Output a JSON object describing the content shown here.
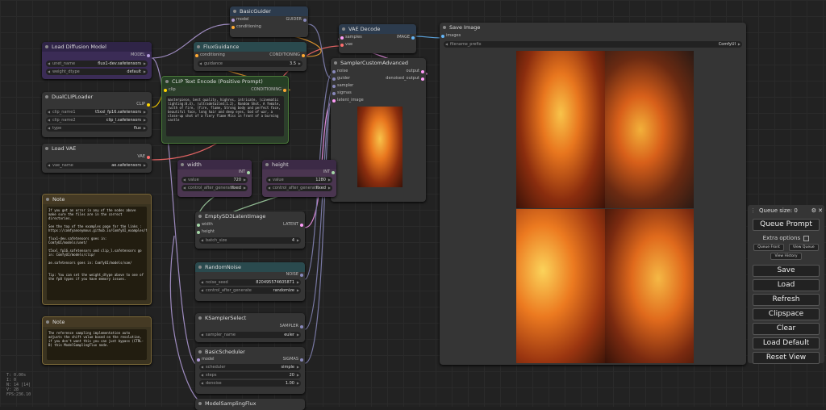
{
  "nodes": {
    "basic_guider": {
      "title": "BasicGuider",
      "in1": "model",
      "in2": "conditioning",
      "out": "GUIDER"
    },
    "vae_decode": {
      "title": "VAE Decode",
      "in1": "samples",
      "in2": "vae",
      "out": "IMAGE"
    },
    "save_image": {
      "title": "Save Image",
      "in1": "images",
      "prefix_key": "filename_prefix",
      "prefix_val": "ComfyUI"
    },
    "load_diffusion": {
      "title": "Load Diffusion Model",
      "out": "MODEL",
      "unet_key": "unet_name",
      "unet_val": "flux1-dev.safetensors",
      "dtype_key": "weight_dtype",
      "dtype_val": "default"
    },
    "flux_guidance": {
      "title": "FluxGuidance",
      "in1": "conditioning",
      "out": "CONDITIONING",
      "g_key": "guidance",
      "g_val": "3.5"
    },
    "sampler_adv": {
      "title": "SamplerCustomAdvanced",
      "in1": "noise",
      "in2": "guider",
      "in3": "sampler",
      "in4": "sigmas",
      "in5": "latent_image",
      "out1": "output",
      "out2": "denoised_output"
    },
    "clip_encode": {
      "title": "CLIP Text Encode (Positive Prompt)",
      "in1": "clip",
      "out": "CONDITIONING",
      "text": "masterpiece, best quality, highres, intricate, (cinematic lighting:0.4), (ultradetailed:1.2), Random Shot, A female, (with of fire, (fire, flame, Strong body and perfect face, beautiful face, long hair and deep eyes, God of war, a close-up shot of a fiery flame Miss in front of a burning castle"
    },
    "dual_clip": {
      "title": "DualCLIPLoader",
      "out": "CLIP",
      "c1_key": "clip_name1",
      "c1_val": "t5xxl_fp16.safetensors",
      "c2_key": "clip_name2",
      "c2_val": "clip_l.safetensors",
      "type_key": "type",
      "type_val": "flux"
    },
    "load_vae": {
      "title": "Load VAE",
      "out": "VAE",
      "v_key": "vae_name",
      "v_val": "ae.safetensors"
    },
    "width": {
      "title": "width",
      "out": "INT",
      "v_key": "value",
      "v_val": "720",
      "c_key": "control_after_generate",
      "c_val": "fixed"
    },
    "height": {
      "title": "height",
      "out": "INT",
      "v_key": "value",
      "v_val": "1280",
      "c_key": "control_after_generate",
      "c_val": "fixed"
    },
    "empty_latent": {
      "title": "EmptySD3LatentImage",
      "in1": "width",
      "in2": "height",
      "out": "LATENT",
      "b_key": "batch_size",
      "b_val": "4"
    },
    "random_noise": {
      "title": "RandomNoise",
      "out": "NOISE",
      "s_key": "noise_seed",
      "s_val": "820495574605871",
      "c_key": "control_after_generate",
      "c_val": "randomize"
    },
    "ksampler_select": {
      "title": "KSamplerSelect",
      "out": "SAMPLER",
      "s_key": "sampler_name",
      "s_val": "euler"
    },
    "basic_scheduler": {
      "title": "BasicScheduler",
      "in1": "model",
      "out": "SIGMAS",
      "sc_key": "scheduler",
      "sc_val": "simple",
      "st_key": "steps",
      "st_val": "20",
      "d_key": "denoise",
      "d_val": "1.00"
    },
    "model_sampling": {
      "title": "ModelSamplingFlux"
    },
    "note1": {
      "title": "Note",
      "text": "If you get an error in any of the nodes above make sure the files are in the correct directories.\n\nSee the top of the examples page for the links :\nhttps://comfyanonymous.github.io/ComfyUI_examples/flux/\n\nflux1-dev.safetensors goes in: ComfyUI/models/unet/\n\nt5xxl_fp16.safetensors and clip_l.safetensors go in: ComfyUI/models/clip/\n\nae.safetensors goes in: ComfyUI/models/vae/\n\n\nTip: You can set the weight_dtype above to one of the fp8 types if you have memory issues."
    },
    "note2": {
      "title": "Note",
      "text": "The reference sampling implementation auto adjusts the shift value based on the resolution, if you don't want this you can just bypass (CTRL-B) this ModelSamplingFlux node."
    }
  },
  "panel": {
    "queue_size": "Queue size: 0",
    "queue_prompt": "Queue Prompt",
    "extra_options": "Extra options",
    "queue_front": "Queue Front",
    "view_queue": "View Queue",
    "view_history": "View History",
    "save": "Save",
    "load": "Load",
    "refresh": "Refresh",
    "clipspace": "Clipspace",
    "clear": "Clear",
    "load_default": "Load Default",
    "reset_view": "Reset View"
  },
  "stats": {
    "l1": "T: 0.00s",
    "l2": "I: 0",
    "l3": "N: 14 [14]",
    "l4": "V: 28",
    "l5": "FPS:236.10"
  },
  "colors": {
    "model": "#b39ddb",
    "clip": "#ffd500",
    "vae": "#ff6e6e",
    "cond": "#ffa931",
    "latent": "#ff9cf9",
    "image": "#64b5f6",
    "int": "#a5d6a7"
  }
}
